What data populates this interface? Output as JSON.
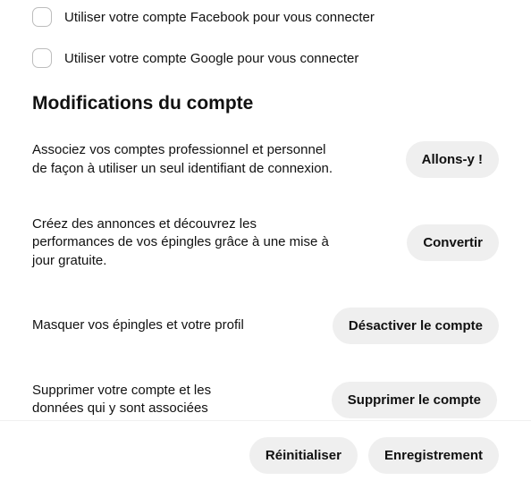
{
  "login_options": {
    "facebook_label": "Utiliser votre compte Facebook pour vous connecter",
    "google_label": "Utiliser votre compte Google pour vous connecter"
  },
  "section_title": "Modifications du compte",
  "rows": {
    "link": {
      "desc": "Associez vos comptes professionnel et personnel de façon à utiliser un seul identifiant de connexion.",
      "button": "Allons-y !"
    },
    "convert": {
      "desc": "Créez des annonces et découvrez les performances de vos épingles grâce à une mise à jour gratuite.",
      "button": "Convertir"
    },
    "deactivate": {
      "desc": "Masquer vos épingles et votre profil",
      "button": "Désactiver le compte"
    },
    "delete": {
      "desc": "Supprimer votre compte et les données qui y sont associées",
      "button": "Supprimer le compte"
    }
  },
  "footer": {
    "reset": "Réinitialiser",
    "save": "Enregistrement"
  }
}
